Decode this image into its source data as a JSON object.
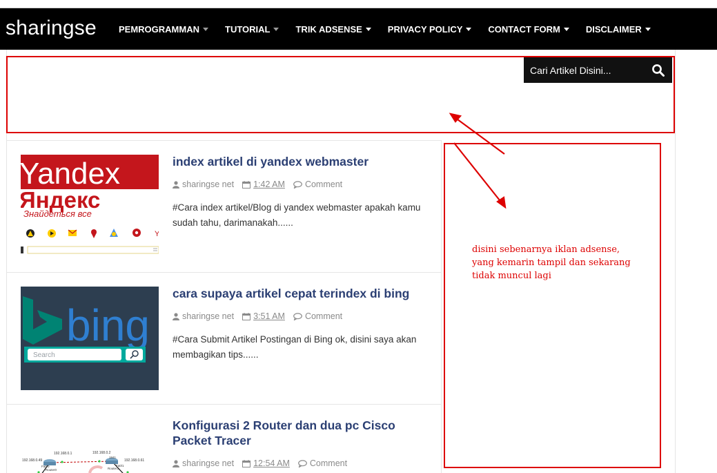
{
  "header": {
    "logo": "sharingse",
    "menu": [
      {
        "label": "PEMROGRAMMAN",
        "caret": "grey"
      },
      {
        "label": "TUTORIAL",
        "caret": "grey"
      },
      {
        "label": "TRIK ADSENSE",
        "caret": "white"
      },
      {
        "label": "PRIVACY POLICY",
        "caret": "white"
      },
      {
        "label": "CONTACT FORM",
        "caret": "white"
      },
      {
        "label": "DISCLAIMER",
        "caret": "white"
      }
    ]
  },
  "search": {
    "placeholder": "Cari Artikel Disini...",
    "icon": "search-icon"
  },
  "posts": [
    {
      "title": "index artikel di yandex webmaster",
      "author": "sharingse net",
      "time": "1:42 AM",
      "comment": "Comment",
      "excerpt": "#Cara index artikel/Blog di yandex webmaster apakah kamu sudah tahu, darimanakah......",
      "thumb": {
        "brand": "Yandex",
        "brand_cyr": "Яндекс",
        "tagline": "Знайдеться все"
      }
    },
    {
      "title": "cara supaya artikel cepat terindex di bing",
      "author": "sharingse net",
      "time": "3:51 AM",
      "comment": "Comment",
      "excerpt": "#Cara Submit Artikel Postingan di Bing ok, disini saya akan membagikan tips......",
      "thumb": {
        "brand": "bing",
        "search_placeholder": "Search"
      }
    },
    {
      "title": "Konfigurasi 2 Router dan dua pc Cisco Packet Tracer",
      "author": "sharingse net",
      "time": "12:54 AM",
      "comment": "Comment",
      "excerpt": "",
      "thumb": {
        "labels": [
          "192.168.0.1",
          "192.168.0.2",
          "192.168.0.49",
          "192.168.0.61",
          "Router0",
          "Router1",
          "Fa0/0",
          "Fa0/1",
          "1841"
        ]
      }
    }
  ],
  "annotation": {
    "text": "disini sebenarnya iklan adsense, yang kemarin tampil dan sekarang tidak muncul lagi"
  },
  "colors": {
    "nav_bg": "#000000",
    "title_blue": "#2b3f73",
    "annotation_red": "#dd0000",
    "bing_bg": "#2d3e50",
    "bing_teal": "#008373",
    "yandex_red": "#c4161c"
  }
}
